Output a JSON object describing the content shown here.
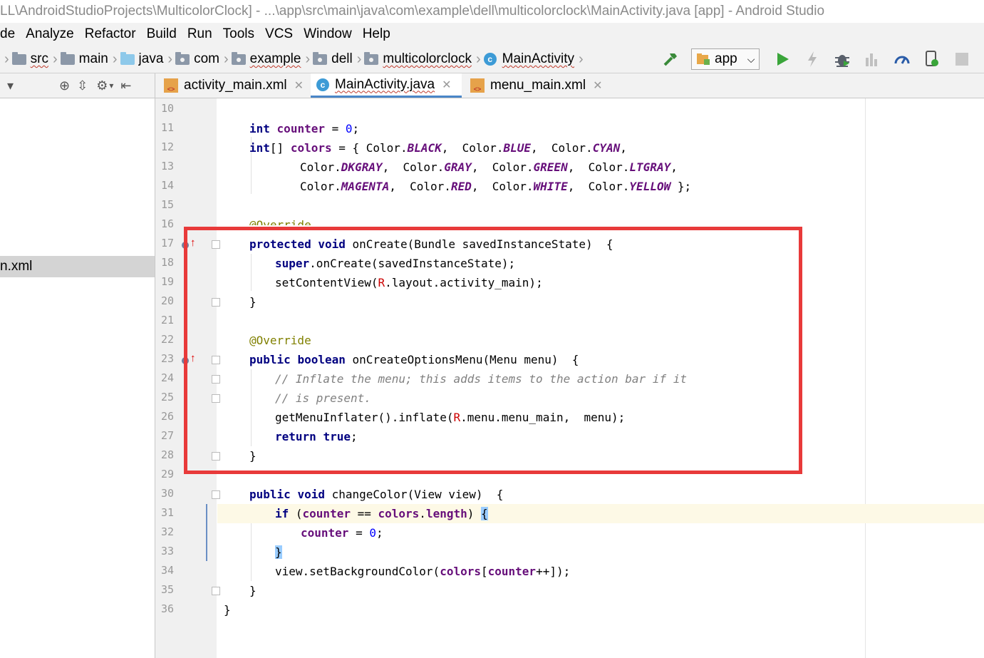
{
  "window": {
    "title": "LL\\AndroidStudioProjects\\MulticolorClock] - ...\\app\\src\\main\\java\\com\\example\\dell\\multicolorclock\\MainActivity.java [app] - Android Studio"
  },
  "menu": [
    "de",
    "Analyze",
    "Refactor",
    "Build",
    "Run",
    "Tools",
    "VCS",
    "Window",
    "Help"
  ],
  "breadcrumbs": [
    "src",
    "main",
    "java",
    "com",
    "example",
    "dell",
    "multicolorclock",
    "MainActivity"
  ],
  "run_config": {
    "label": "app"
  },
  "toolbar_icons": [
    "hammer-icon",
    "run-icon",
    "apply-changes-icon",
    "debug-icon",
    "attach-icon",
    "profiler-icon",
    "device-icon",
    "stop-icon"
  ],
  "tabs": [
    {
      "label": "activity_main.xml",
      "icon": "xml-icon"
    },
    {
      "label": "MainActivity.java",
      "icon": "class-icon",
      "active": true
    },
    {
      "label": "menu_main.xml",
      "icon": "xml-icon"
    }
  ],
  "sidebar": {
    "selected_item": "n.xml"
  },
  "code": {
    "line_numbers": [
      "10",
      "11",
      "12",
      "13",
      "14",
      "15",
      "16",
      "17",
      "18",
      "19",
      "20",
      "21",
      "22",
      "23",
      "24",
      "25",
      "26",
      "27",
      "28",
      "29",
      "30",
      "31",
      "32",
      "33",
      "34",
      "35",
      "36"
    ],
    "l11": {
      "kw": "int",
      "f": "counter",
      "eq": " = ",
      "n": "0",
      "end": ";"
    },
    "l12": {
      "kw": "int",
      "a": "[] ",
      "f": "colors",
      "b": " = { Color.",
      "c1": "BLACK",
      "s1": ",  Color.",
      "c2": "BLUE",
      "s2": ",  Color.",
      "c3": "CYAN",
      "e": ","
    },
    "l13": {
      "a": "Color.",
      "c1": "DKGRAY",
      "s1": ",  Color.",
      "c2": "GRAY",
      "s2": ",  Color.",
      "c3": "GREEN",
      "s3": ",  Color.",
      "c4": "LTGRAY",
      "e": ","
    },
    "l14": {
      "a": "Color.",
      "c1": "MAGENTA",
      "s1": ",  Color.",
      "c2": "RED",
      "s2": ",  Color.",
      "c3": "WHITE",
      "s3": ",  Color.",
      "c4": "YELLOW",
      "e": " };"
    },
    "l16": {
      "ann": "@Override"
    },
    "l17": {
      "kw1": "protected",
      "kw2": "void",
      "rest": " onCreate(Bundle savedInstanceState)  {"
    },
    "l18": {
      "kw": "super",
      "rest": ".onCreate(savedInstanceState);"
    },
    "l19": {
      "a": "setContentView(",
      "r": "R",
      "rest": ".layout.activity_main);"
    },
    "l20": {
      "t": "}"
    },
    "l22": {
      "ann": "@Override"
    },
    "l23": {
      "kw1": "public",
      "kw2": "boolean",
      "rest": " onCreateOptionsMenu(Menu menu)  {"
    },
    "l24": {
      "cmt": "// Inflate the menu; this adds items to the action bar if it"
    },
    "l25": {
      "cmt": "// is present."
    },
    "l26": {
      "a": "getMenuInflater().inflate(",
      "r": "R",
      "rest": ".menu.menu_main,  menu);"
    },
    "l27": {
      "kw1": "return",
      "kw2": "true",
      "end": ";"
    },
    "l28": {
      "t": "}"
    },
    "l30": {
      "kw1": "public",
      "kw2": "void",
      "rest": " changeColor(View view)  {"
    },
    "l31": {
      "kw": "if",
      "a": " (",
      "f1": "counter",
      "b": " == ",
      "f2": "colors",
      "c": ".",
      "f3": "length",
      "d": ") ",
      "br": "{"
    },
    "l32": {
      "f": "counter",
      "eq": " = ",
      "n": "0",
      "end": ";"
    },
    "l33": {
      "br": "}"
    },
    "l34": {
      "a": "view.setBackgroundColor(",
      "f1": "colors",
      "b": "[",
      "f2": "counter",
      "c": "++]);"
    },
    "l35": {
      "t": "}"
    },
    "l36": {
      "t": "}"
    }
  }
}
